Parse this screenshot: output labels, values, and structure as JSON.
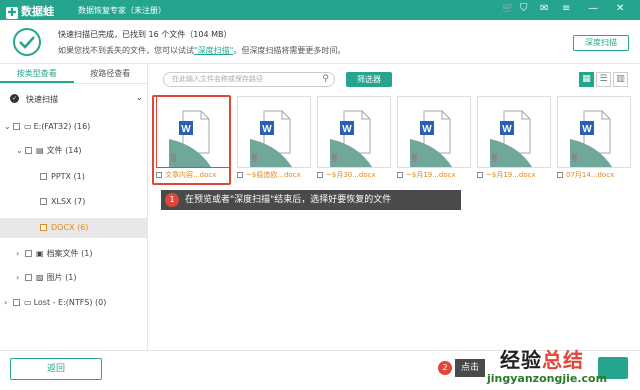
{
  "app": {
    "logo_text": "数据蛙",
    "title": "数据恢复专家（未注册）"
  },
  "titlebar_icons": [
    "cart-icon",
    "shield-icon",
    "mail-icon",
    "menu-icon",
    "minimize-icon",
    "close-icon"
  ],
  "info": {
    "line1": "快速扫描已完成，已找到 16 个文件（104 MB）",
    "line2_prefix": "如果您找不到丢失的文件，您可以试试",
    "line2_link": "\"深度扫描\"",
    "line2_suffix": "。但深度扫描将需要更多时间。",
    "deep_scan_button": "深度扫描"
  },
  "sidebar": {
    "tabs": [
      "按类型查看",
      "按路径查看"
    ],
    "active_tab": 0,
    "quick_scan_label": "快速扫描",
    "tree": [
      {
        "label": "E:(FAT32) (16)"
      },
      {
        "label": "文件 (14)"
      },
      {
        "label": "PPTX (1)"
      },
      {
        "label": "XLSX (7)"
      },
      {
        "label": "DOCX (6)"
      },
      {
        "label": "档案文件 (1)"
      },
      {
        "label": "图片 (1)"
      },
      {
        "label": "Lost - E:(NTFS) (0)"
      }
    ],
    "selected_index": 4
  },
  "toolbar": {
    "search_placeholder": "在此输入文件名称或保存路径",
    "filter_button": "筛选器",
    "views": [
      "grid-view-icon",
      "list-view-icon",
      "detail-view-icon"
    ]
  },
  "files": [
    {
      "name": "文章内容...docx"
    },
    {
      "name": "~$稳造欧...docx"
    },
    {
      "name": "~$月30...docx"
    },
    {
      "name": "~$月19...docx"
    },
    {
      "name": "~$月19...docx"
    },
    {
      "name": "07月14...docx"
    }
  ],
  "tip1": {
    "number": "1",
    "text": "在预览或者\"深度扫描\"结束后，选择好要恢复的文件"
  },
  "bottom": {
    "back_button": "返回",
    "tip2_number": "2",
    "tip2_text": "点击"
  },
  "watermark": {
    "text_a": "经验",
    "text_b": "总结",
    "url": "jingyanzongjie.com"
  },
  "colors": {
    "accent": "#25a58e",
    "highlight": "#e0463a",
    "selected_text": "#e08a1e"
  }
}
